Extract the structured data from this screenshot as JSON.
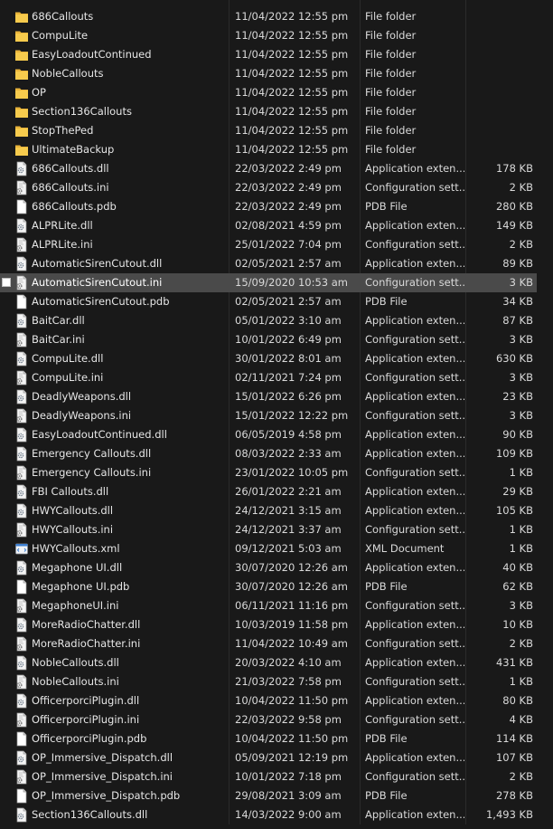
{
  "files": [
    {
      "name": "686Callouts",
      "date": "11/04/2022 12:55 pm",
      "type": "File folder",
      "size": "",
      "icon": "folder-icon"
    },
    {
      "name": "CompuLite",
      "date": "11/04/2022 12:55 pm",
      "type": "File folder",
      "size": "",
      "icon": "folder-icon"
    },
    {
      "name": "EasyLoadoutContinued",
      "date": "11/04/2022 12:55 pm",
      "type": "File folder",
      "size": "",
      "icon": "folder-icon"
    },
    {
      "name": "NobleCallouts",
      "date": "11/04/2022 12:55 pm",
      "type": "File folder",
      "size": "",
      "icon": "folder-icon"
    },
    {
      "name": "OP",
      "date": "11/04/2022 12:55 pm",
      "type": "File folder",
      "size": "",
      "icon": "folder-icon"
    },
    {
      "name": "Section136Callouts",
      "date": "11/04/2022 12:55 pm",
      "type": "File folder",
      "size": "",
      "icon": "folder-icon"
    },
    {
      "name": "StopThePed",
      "date": "11/04/2022 12:55 pm",
      "type": "File folder",
      "size": "",
      "icon": "folder-icon"
    },
    {
      "name": "UltimateBackup",
      "date": "11/04/2022 12:55 pm",
      "type": "File folder",
      "size": "",
      "icon": "folder-icon"
    },
    {
      "name": "686Callouts.dll",
      "date": "22/03/2022 2:49 pm",
      "type": "Application exten...",
      "size": "178 KB",
      "icon": "dll-file-icon"
    },
    {
      "name": "686Callouts.ini",
      "date": "22/03/2022 2:49 pm",
      "type": "Configuration sett...",
      "size": "2 KB",
      "icon": "ini-file-icon"
    },
    {
      "name": "686Callouts.pdb",
      "date": "22/03/2022 2:49 pm",
      "type": "PDB File",
      "size": "280 KB",
      "icon": "blank-file-icon"
    },
    {
      "name": "ALPRLite.dll",
      "date": "02/08/2021 4:59 pm",
      "type": "Application exten...",
      "size": "149 KB",
      "icon": "dll-file-icon"
    },
    {
      "name": "ALPRLite.ini",
      "date": "25/01/2022 7:04 pm",
      "type": "Configuration sett...",
      "size": "2 KB",
      "icon": "ini-file-icon"
    },
    {
      "name": "AutomaticSirenCutout.dll",
      "date": "02/05/2021 2:57 am",
      "type": "Application exten...",
      "size": "89 KB",
      "icon": "dll-file-icon"
    },
    {
      "name": "AutomaticSirenCutout.ini",
      "date": "15/09/2020 10:53 am",
      "type": "Configuration sett...",
      "size": "3 KB",
      "icon": "ini-file-icon",
      "selected": true
    },
    {
      "name": "AutomaticSirenCutout.pdb",
      "date": "02/05/2021 2:57 am",
      "type": "PDB File",
      "size": "34 KB",
      "icon": "blank-file-icon"
    },
    {
      "name": "BaitCar.dll",
      "date": "05/01/2022 3:10 am",
      "type": "Application exten...",
      "size": "87 KB",
      "icon": "dll-file-icon"
    },
    {
      "name": "BaitCar.ini",
      "date": "10/01/2022 6:49 pm",
      "type": "Configuration sett...",
      "size": "3 KB",
      "icon": "ini-file-icon"
    },
    {
      "name": "CompuLite.dll",
      "date": "30/01/2022 8:01 am",
      "type": "Application exten...",
      "size": "630 KB",
      "icon": "dll-file-icon"
    },
    {
      "name": "CompuLite.ini",
      "date": "02/11/2021 7:24 pm",
      "type": "Configuration sett...",
      "size": "3 KB",
      "icon": "ini-file-icon"
    },
    {
      "name": "DeadlyWeapons.dll",
      "date": "15/01/2022 6:26 pm",
      "type": "Application exten...",
      "size": "23 KB",
      "icon": "dll-file-icon"
    },
    {
      "name": "DeadlyWeapons.ini",
      "date": "15/01/2022 12:22 pm",
      "type": "Configuration sett...",
      "size": "3 KB",
      "icon": "ini-file-icon"
    },
    {
      "name": "EasyLoadoutContinued.dll",
      "date": "06/05/2019 4:58 pm",
      "type": "Application exten...",
      "size": "90 KB",
      "icon": "dll-file-icon"
    },
    {
      "name": "Emergency Callouts.dll",
      "date": "08/03/2022 2:33 am",
      "type": "Application exten...",
      "size": "109 KB",
      "icon": "dll-file-icon"
    },
    {
      "name": "Emergency Callouts.ini",
      "date": "23/01/2022 10:05 pm",
      "type": "Configuration sett...",
      "size": "1 KB",
      "icon": "ini-file-icon"
    },
    {
      "name": "FBI Callouts.dll",
      "date": "26/01/2022 2:21 am",
      "type": "Application exten...",
      "size": "29 KB",
      "icon": "dll-file-icon"
    },
    {
      "name": "HWYCallouts.dll",
      "date": "24/12/2021 3:15 am",
      "type": "Application exten...",
      "size": "105 KB",
      "icon": "dll-file-icon"
    },
    {
      "name": "HWYCallouts.ini",
      "date": "24/12/2021 3:37 am",
      "type": "Configuration sett...",
      "size": "1 KB",
      "icon": "ini-file-icon"
    },
    {
      "name": "HWYCallouts.xml",
      "date": "09/12/2021 5:03 am",
      "type": "XML Document",
      "size": "1 KB",
      "icon": "xml-file-icon"
    },
    {
      "name": "Megaphone UI.dll",
      "date": "30/07/2020 12:26 am",
      "type": "Application exten...",
      "size": "40 KB",
      "icon": "dll-file-icon"
    },
    {
      "name": "Megaphone UI.pdb",
      "date": "30/07/2020 12:26 am",
      "type": "PDB File",
      "size": "62 KB",
      "icon": "blank-file-icon"
    },
    {
      "name": "MegaphoneUI.ini",
      "date": "06/11/2021 11:16 pm",
      "type": "Configuration sett...",
      "size": "3 KB",
      "icon": "ini-file-icon"
    },
    {
      "name": "MoreRadioChatter.dll",
      "date": "10/03/2019 11:58 pm",
      "type": "Application exten...",
      "size": "10 KB",
      "icon": "dll-file-icon"
    },
    {
      "name": "MoreRadioChatter.ini",
      "date": "11/04/2022 10:49 am",
      "type": "Configuration sett...",
      "size": "2 KB",
      "icon": "ini-file-icon"
    },
    {
      "name": "NobleCallouts.dll",
      "date": "20/03/2022 4:10 am",
      "type": "Application exten...",
      "size": "431 KB",
      "icon": "dll-file-icon"
    },
    {
      "name": "NobleCallouts.ini",
      "date": "21/03/2022 7:58 pm",
      "type": "Configuration sett...",
      "size": "1 KB",
      "icon": "ini-file-icon"
    },
    {
      "name": "OfficerporciPlugin.dll",
      "date": "10/04/2022 11:50 pm",
      "type": "Application exten...",
      "size": "80 KB",
      "icon": "dll-file-icon"
    },
    {
      "name": "OfficerporciPlugin.ini",
      "date": "22/03/2022 9:58 pm",
      "type": "Configuration sett...",
      "size": "4 KB",
      "icon": "ini-file-icon"
    },
    {
      "name": "OfficerporciPlugin.pdb",
      "date": "10/04/2022 11:50 pm",
      "type": "PDB File",
      "size": "114 KB",
      "icon": "blank-file-icon"
    },
    {
      "name": "OP_Immersive_Dispatch.dll",
      "date": "05/09/2021 12:19 pm",
      "type": "Application exten...",
      "size": "107 KB",
      "icon": "dll-file-icon"
    },
    {
      "name": "OP_Immersive_Dispatch.ini",
      "date": "10/01/2022 7:18 pm",
      "type": "Configuration sett...",
      "size": "2 KB",
      "icon": "ini-file-icon"
    },
    {
      "name": "OP_Immersive_Dispatch.pdb",
      "date": "29/08/2021 3:09 am",
      "type": "PDB File",
      "size": "278 KB",
      "icon": "blank-file-icon"
    },
    {
      "name": "Section136Callouts.dll",
      "date": "14/03/2022 9:00 am",
      "type": "Application exten...",
      "size": "1,493 KB",
      "icon": "dll-file-icon"
    }
  ]
}
